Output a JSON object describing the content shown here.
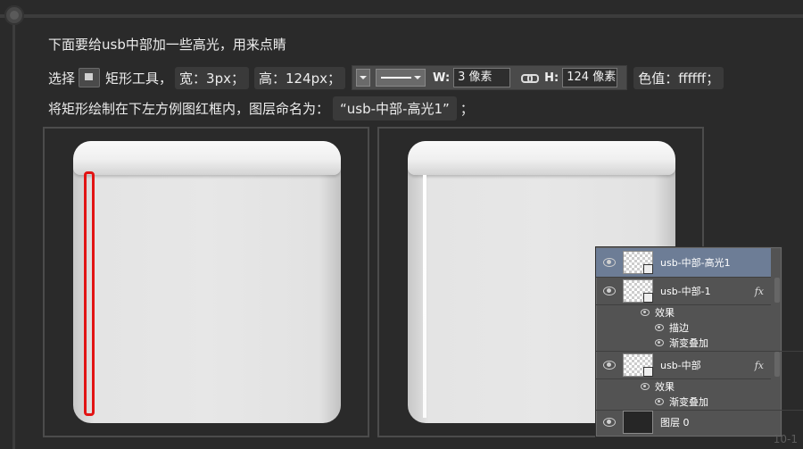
{
  "instructions": {
    "line1": "下面要给usb中部加一些高光，用来点睛",
    "line2_select": "选择",
    "line2_tool": "矩形工具，",
    "line2_width": "宽：3px；",
    "line2_height": "高：124px；",
    "w_label": "W:",
    "w_value": "3 像素",
    "h_label": "H:",
    "h_value": "124 像素",
    "color_value": "色值：ffffff；",
    "line3_prefix": "将矩形绘制在下左方例图红框内，图层命名为：",
    "layer_name_quote": "“usb-中部-高光1”",
    "line3_suffix": "；"
  },
  "layers_panel": {
    "layers": [
      {
        "name": "usb-中部-高光1",
        "selected": true,
        "fx": ""
      },
      {
        "name": "usb-中部-1",
        "selected": false,
        "fx": "fx"
      },
      {
        "name": "usb-中部",
        "selected": false,
        "fx": "fx"
      },
      {
        "name": "图层 0",
        "selected": false,
        "fx": ""
      }
    ],
    "effects_label": "效果",
    "effect_stroke": "描边",
    "effect_gradient": "渐变叠加",
    "effect_gradient2": "渐变叠加"
  },
  "colors": {
    "highlight_fill": "#ffffff",
    "frame_red": "#e21414",
    "selected_layer": "#6d7d96"
  },
  "page_number": "10-1"
}
